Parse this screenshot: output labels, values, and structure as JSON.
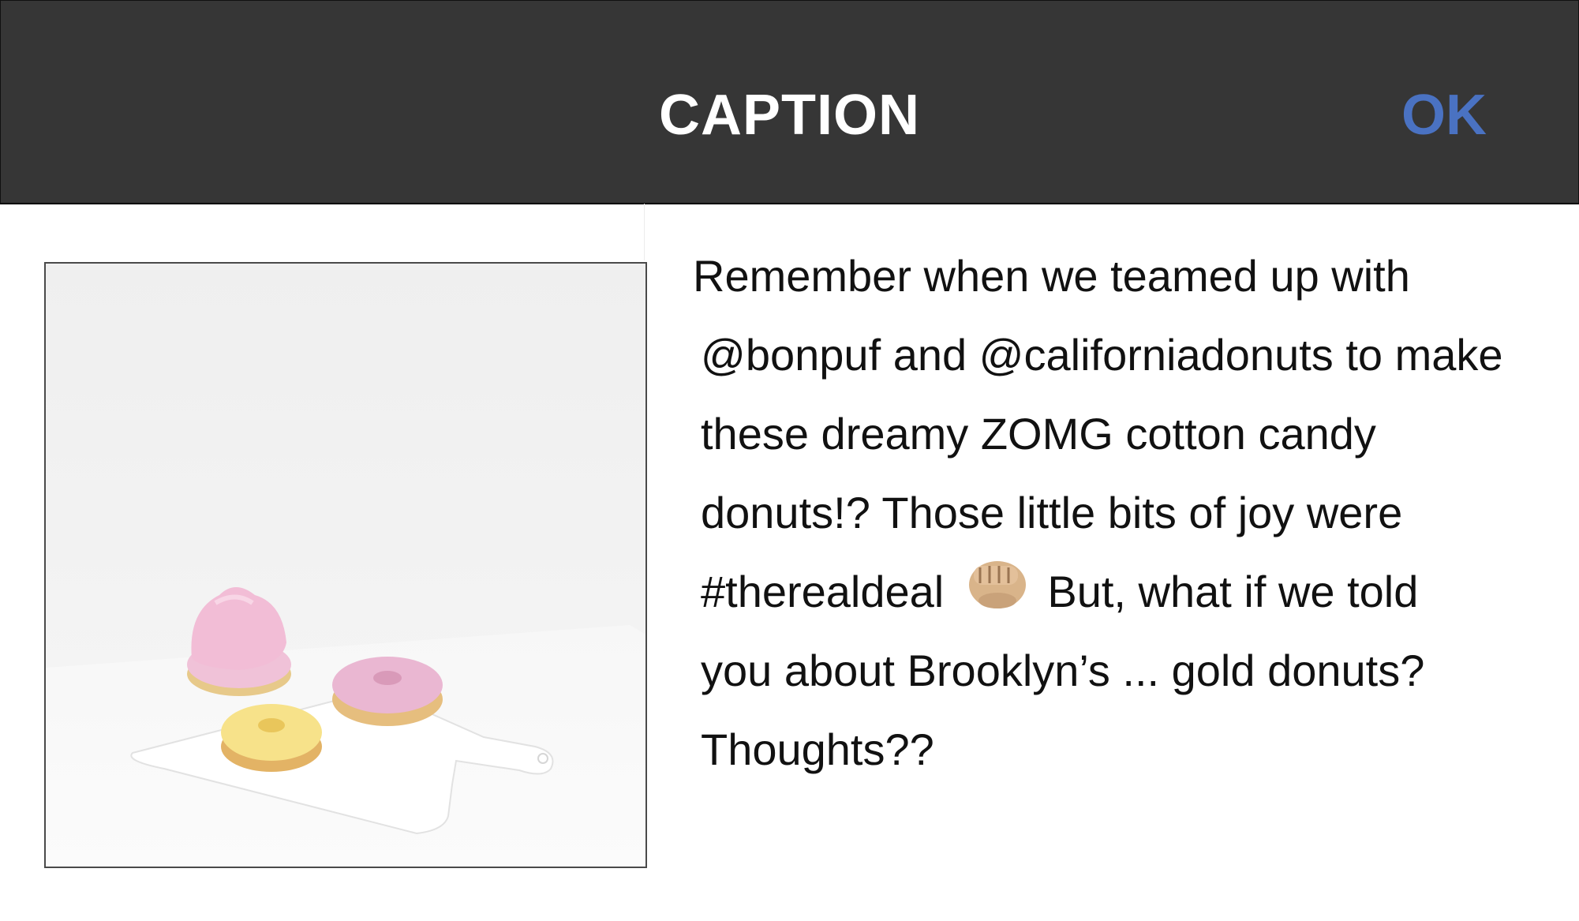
{
  "header": {
    "title": "CAPTION",
    "ok_label": "OK"
  },
  "colors": {
    "header_bg": "#363636",
    "accent": "#4a72c2"
  },
  "caption": {
    "line1": "Remember when we teamed up with",
    "line2": "@bonpuf and @californiadonuts to make",
    "line3": "these dreamy ZOMG cotton candy",
    "line4": "donuts!? Those little bits of joy were",
    "line5_before_emoji": "#therealdeal",
    "emoji": "fist-bump-icon",
    "line5_after_emoji": "But, what if we told",
    "line6": "you about Brooklyn’s ... gold donuts?",
    "line7": "Thoughts??"
  },
  "photo": {
    "subject": "donuts-photo"
  }
}
